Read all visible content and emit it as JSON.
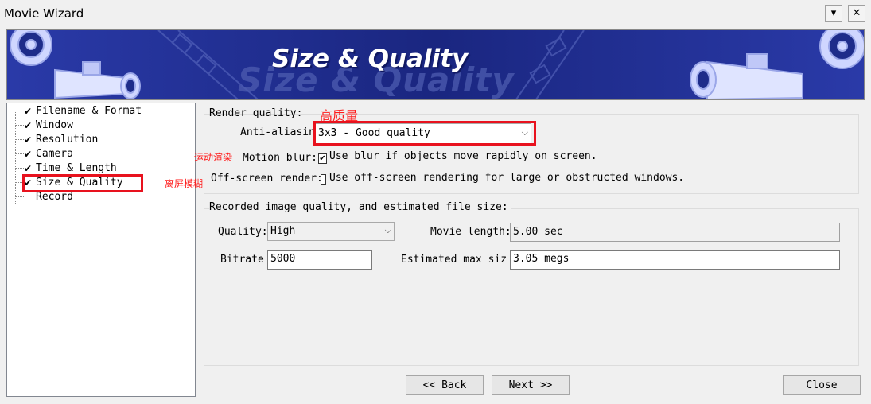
{
  "window": {
    "title": "Movie Wizard",
    "menu_glyph": "▾",
    "close_glyph": "✕"
  },
  "banner": {
    "title": "Size & Quality",
    "title_ghost": "Size & Quality"
  },
  "steps": [
    {
      "label": "Filename & Format",
      "done": true
    },
    {
      "label": "Window",
      "done": true
    },
    {
      "label": "Resolution",
      "done": true
    },
    {
      "label": "Camera",
      "done": true
    },
    {
      "label": "Time & Length",
      "done": true
    },
    {
      "label": "Size & Quality",
      "done": true,
      "current": true
    },
    {
      "label": "Record",
      "done": false
    }
  ],
  "render_quality": {
    "group_label": "Render quality:",
    "anti_aliasing_label": "Anti-aliasin",
    "anti_aliasing_value": "3x3 - Good quality",
    "motion_blur_label": "Motion blur:",
    "motion_blur_checked": true,
    "motion_blur_text": "Use blur if objects move rapidly on screen.",
    "offscreen_label": "Off-screen render:",
    "offscreen_checked": false,
    "offscreen_text": "Use off-screen rendering for large or obstructed windows."
  },
  "recorded": {
    "group_label": "Recorded image quality, and estimated file size:",
    "quality_label": "Quality:",
    "quality_value": "High",
    "movie_length_label": "Movie length:",
    "movie_length_value": "5.00 sec",
    "bitrate_label": "Bitrate",
    "bitrate_value": "5000",
    "estimated_label": "Estimated max siz",
    "estimated_value": "3.05 megs"
  },
  "buttons": {
    "back": "<< Back",
    "next": "Next >>",
    "close": "Close"
  },
  "annotations": {
    "high_quality": "高质量",
    "motion_render": "运动渲染",
    "offscreen_blur": "离屏模糊"
  },
  "colors": {
    "annotation_red": "#e8121e",
    "banner_blue": "#1e2c8a"
  },
  "icons": {
    "check": "✔",
    "dropdown": "⌵"
  }
}
